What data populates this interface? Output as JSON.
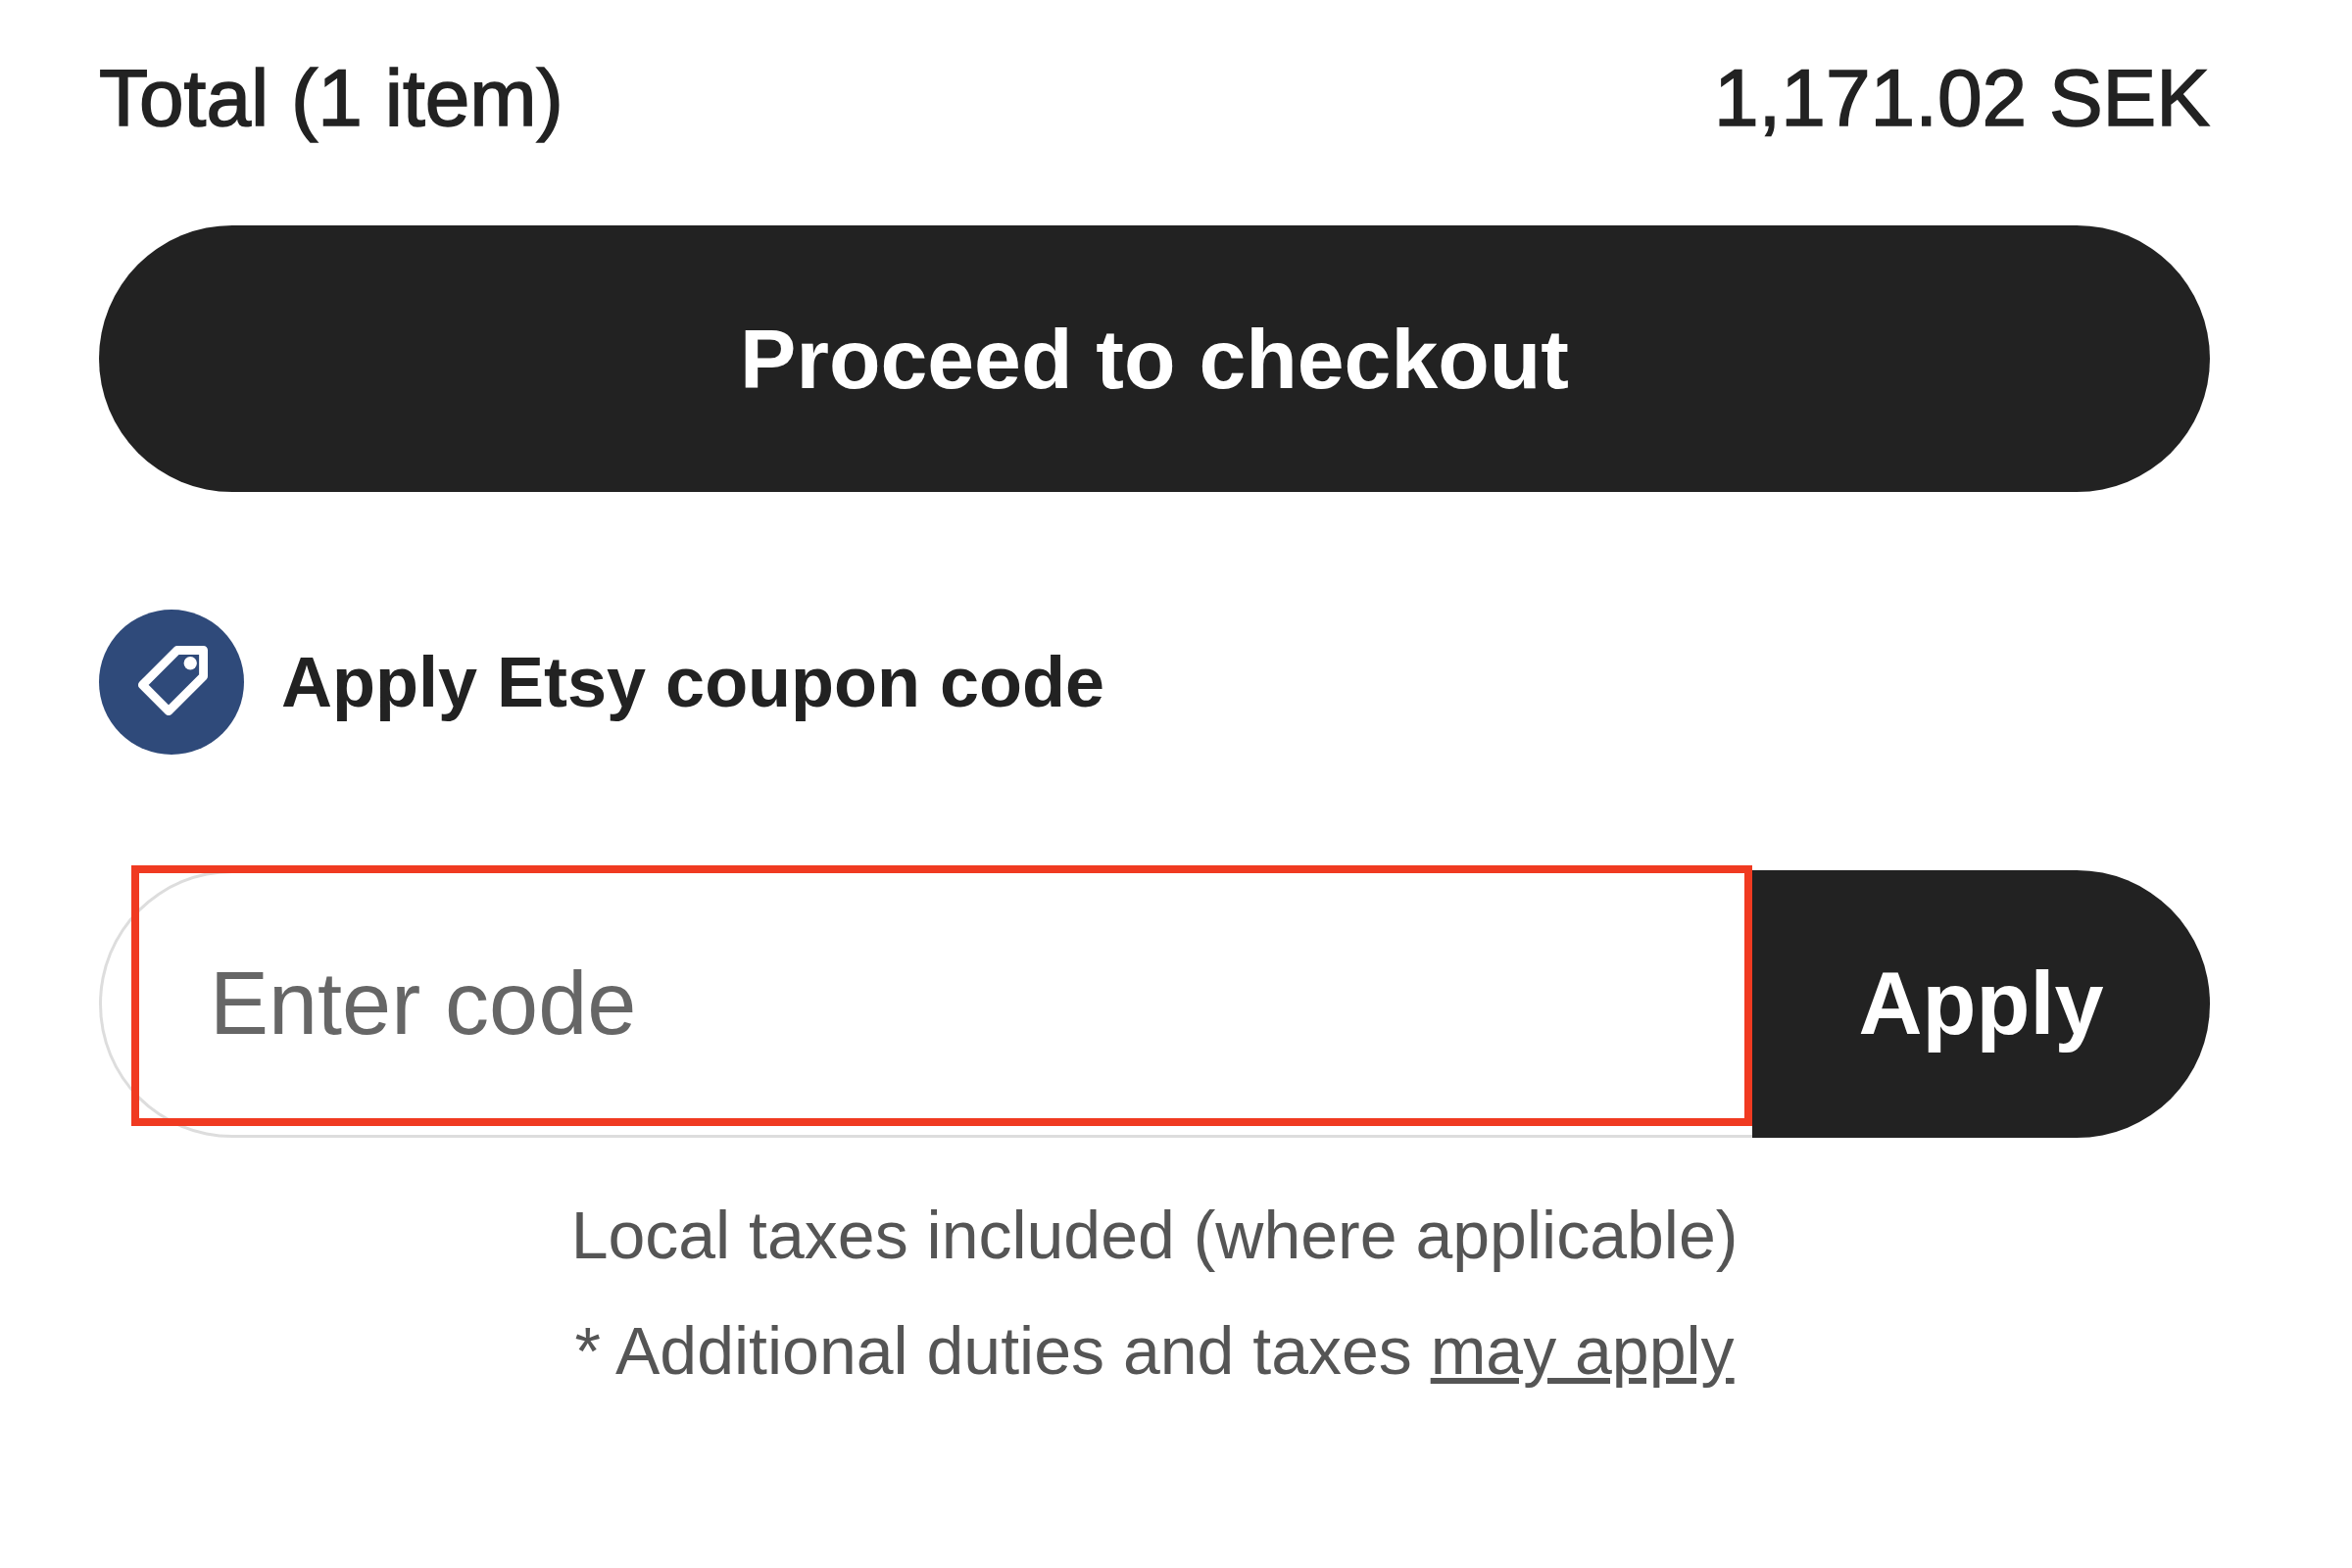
{
  "total": {
    "label": "Total (1 item)",
    "amount": "1,171.02 SEK"
  },
  "checkout_button": "Proceed to checkout",
  "coupon": {
    "label": "Apply Etsy coupon code"
  },
  "code_field": {
    "placeholder": "Enter code",
    "highlighted": true
  },
  "apply_button": "Apply",
  "tax_note": "Local taxes included (where applicable)",
  "duties_note": {
    "text": "* Additional duties and taxes",
    "link": "may apply"
  }
}
